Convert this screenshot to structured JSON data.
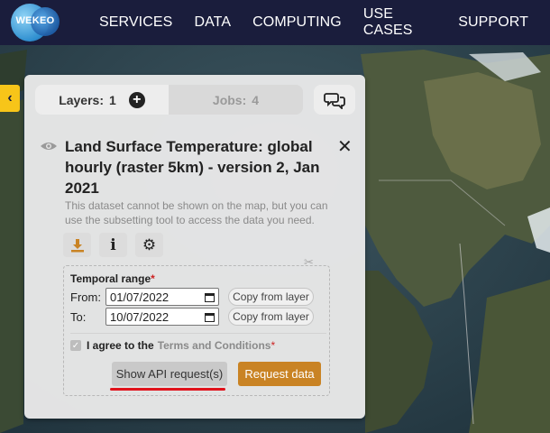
{
  "nav": {
    "logo_text": "WEKEO",
    "items": [
      "SERVICES",
      "DATA",
      "COMPUTING",
      "USE CASES",
      "SUPPORT"
    ]
  },
  "side_toggle": "‹",
  "tabs": {
    "layers_label": "Layers:",
    "layers_count": "1",
    "jobs_label": "Jobs:",
    "jobs_count": "4"
  },
  "dataset": {
    "title": "Land Surface Temperature: global hourly (raster 5km) - version 2, Jan 2021",
    "note": "This dataset cannot be shown on the map, but you can use the subsetting tool to access the data you need."
  },
  "subset": {
    "temporal_label": "Temporal range",
    "required_mark": "*",
    "from_label": "From:",
    "from_value": "01/07/2022",
    "to_label": "To:",
    "to_value": "10/07/2022",
    "copy_label": "Copy from layer",
    "agree_prefix": "I agree to the",
    "terms_link": "Terms and Conditions",
    "api_button": "Show API request(s)",
    "request_button": "Request data"
  },
  "colors": {
    "nav_bg": "#1a1d3c",
    "accent_orange": "#c98324",
    "highlight_red": "#e0121b",
    "toggle_yellow": "#f7c519"
  }
}
